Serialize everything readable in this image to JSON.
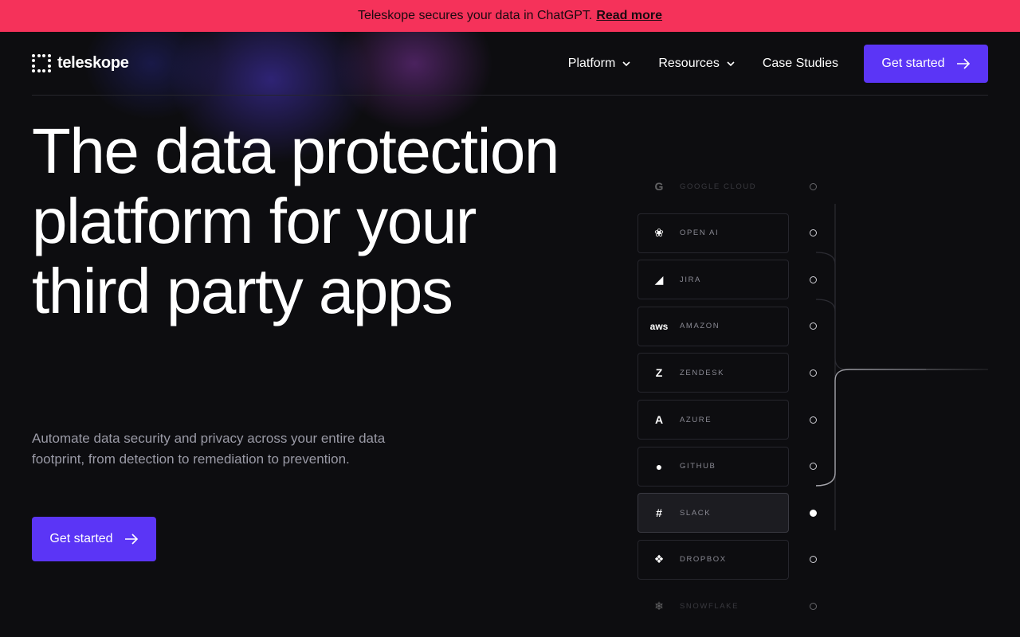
{
  "banner": {
    "text": "Teleskope secures your data in ChatGPT.",
    "link": "Read more"
  },
  "brand": {
    "name": "teleskope"
  },
  "nav": {
    "items": [
      {
        "label": "Platform",
        "has_dropdown": true
      },
      {
        "label": "Resources",
        "has_dropdown": true
      },
      {
        "label": "Case Studies",
        "has_dropdown": false
      }
    ],
    "cta": "Get started"
  },
  "hero": {
    "title_lines": [
      "The data protection",
      "platform for your",
      "third party apps"
    ],
    "subtitle": "Automate data security and privacy across your entire data footprint, from detection to remediation to prevention.",
    "cta": "Get started"
  },
  "apps": [
    {
      "label": "GOOGLE CLOUD",
      "icon": "google-icon",
      "state": "faded"
    },
    {
      "label": "OPEN AI",
      "icon": "openai-icon",
      "state": "normal"
    },
    {
      "label": "JIRA",
      "icon": "jira-icon",
      "state": "normal"
    },
    {
      "label": "AMAZON",
      "icon": "aws-icon",
      "state": "normal"
    },
    {
      "label": "ZENDESK",
      "icon": "zendesk-icon",
      "state": "normal"
    },
    {
      "label": "AZURE",
      "icon": "azure-icon",
      "state": "normal"
    },
    {
      "label": "GITHUB",
      "icon": "github-icon",
      "state": "normal"
    },
    {
      "label": "SLACK",
      "icon": "slack-icon",
      "state": "active"
    },
    {
      "label": "DROPBOX",
      "icon": "dropbox-icon",
      "state": "normal"
    },
    {
      "label": "SNOWFLAKE",
      "icon": "snowflake-icon",
      "state": "faded"
    }
  ],
  "colors": {
    "banner": "#f5325a",
    "accent": "#5b35f6",
    "background": "#0d0d10"
  }
}
